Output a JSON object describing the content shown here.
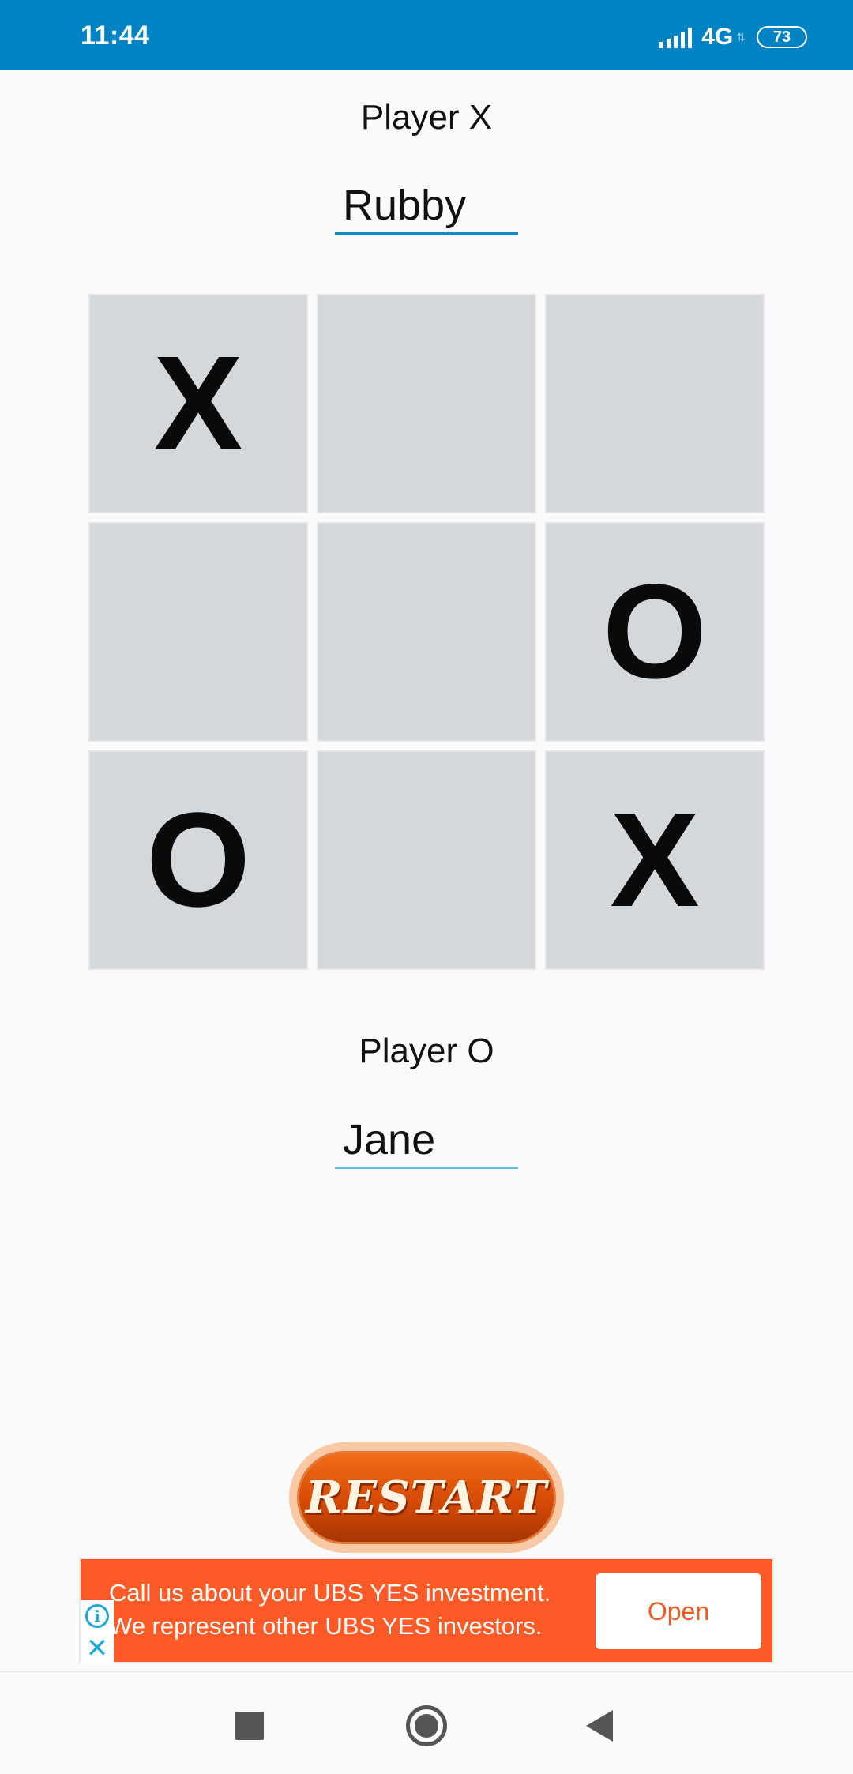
{
  "status_bar": {
    "time": "11:44",
    "network": "4G",
    "battery": "73"
  },
  "player_x": {
    "label": "Player X",
    "name": "Rubby"
  },
  "player_o": {
    "label": "Player O",
    "name": "Jane"
  },
  "board": {
    "cells": [
      "X",
      "",
      "",
      "",
      "",
      "O",
      "O",
      "",
      "X"
    ]
  },
  "restart": {
    "label": "RESTART"
  },
  "ad": {
    "line1": "Call us about your UBS YES investment.",
    "line2": "We represent other UBS YES investors.",
    "open_label": "Open",
    "info_glyph": "i",
    "close_glyph": "✕",
    "background_color": "#fe5a27"
  },
  "colors": {
    "status_bar": "#0083c2",
    "cell_background": "#d2d8dc",
    "input_underline": "#1a87c4"
  }
}
